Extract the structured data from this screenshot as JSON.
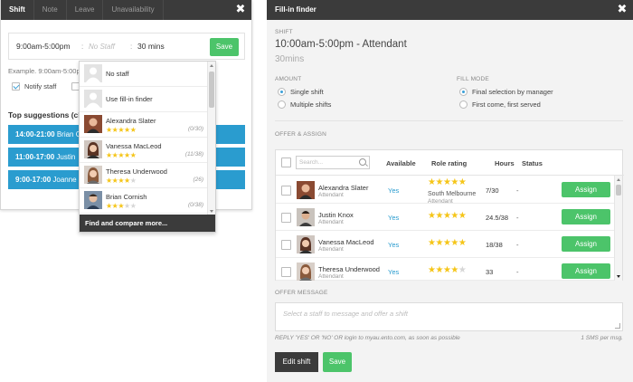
{
  "left_modal": {
    "tabs": [
      "Shift",
      "Note",
      "Leave",
      "Unavailability"
    ],
    "active_tab": 0,
    "time_value": "9:00am-5:00pm",
    "separator": ":",
    "staff_placeholder": "No Staff",
    "duration": "30 mins",
    "save_label": "Save",
    "example_text": "Example. 9:00am-5:00pm",
    "notify_label": "Notify staff",
    "top_suggestions_label": "Top suggestions (clic",
    "suggestions": [
      {
        "time": "14:00-21:00",
        "name": "Brian C"
      },
      {
        "time": "11:00-17:00",
        "name": "Justin"
      },
      {
        "time": "9:00-17:00",
        "name": "Joanne"
      }
    ]
  },
  "dropdown": {
    "items": [
      {
        "name": "No staff",
        "type": "placeholder"
      },
      {
        "name": "Use fill-in finder",
        "type": "placeholder"
      },
      {
        "name": "Alexandra Slater",
        "stars": 5,
        "count": "(0/30)"
      },
      {
        "name": "Vanessa MacLeod",
        "stars": 5,
        "count": "(11/38)"
      },
      {
        "name": "Theresa Underwood",
        "stars": 4,
        "count": "(26)"
      },
      {
        "name": "Brian Cornish",
        "stars": 3,
        "count": "(0/38)"
      }
    ],
    "footer": "Find and compare more..."
  },
  "right_panel": {
    "header": "Fill-in finder",
    "shift_label": "SHIFT",
    "shift_title": "10:00am-5:00pm - Attendant",
    "shift_mins": "30mins",
    "amount_label": "AMOUNT",
    "amount_options": [
      "Single shift",
      "Multiple shifts"
    ],
    "amount_selected": 0,
    "fill_mode_label": "FILL MODE",
    "fill_mode_options": [
      "Final selection by manager",
      "First come, first served"
    ],
    "fill_mode_selected": 0,
    "offer_assign_label": "OFFER & ASSIGN",
    "search_placeholder": "Search...",
    "columns": {
      "available": "Available",
      "role_rating": "Role rating",
      "hours": "Hours",
      "status": "Status"
    },
    "rows": [
      {
        "name": "Alexandra Slater",
        "role": "Attendant",
        "available": "Yes",
        "stars": 5,
        "location": "South Melbourne",
        "location_role": "Attendant",
        "hours": "7/30",
        "status": "-",
        "action": "Assign"
      },
      {
        "name": "Justin Knox",
        "role": "Attendant",
        "available": "Yes",
        "stars": 5,
        "location": "",
        "location_role": "",
        "hours": "24.5/38",
        "status": "-",
        "action": "Assign"
      },
      {
        "name": "Vanessa MacLeod",
        "role": "Attendant",
        "available": "Yes",
        "stars": 5,
        "location": "",
        "location_role": "",
        "hours": "18/38",
        "status": "-",
        "action": "Assign"
      },
      {
        "name": "Theresa Underwood",
        "role": "Attendant",
        "available": "Yes",
        "stars": 4,
        "location": "",
        "location_role": "",
        "hours": "33",
        "status": "-",
        "action": "Assign"
      }
    ],
    "offer_message_label": "OFFER MESSAGE",
    "message_placeholder": "Select a staff to message and offer a shift",
    "reply_note": "REPLY 'YES' OR 'NO' OR login to myau.ento.com, as soon as possible",
    "sms_note": "1 SMS per msg.",
    "edit_shift_label": "Edit shift",
    "save_label": "Save"
  },
  "colors": {
    "dark": "#3b3b3b",
    "accent_blue": "#2a9ccf",
    "green": "#4cc46a",
    "star": "#f5c518"
  }
}
